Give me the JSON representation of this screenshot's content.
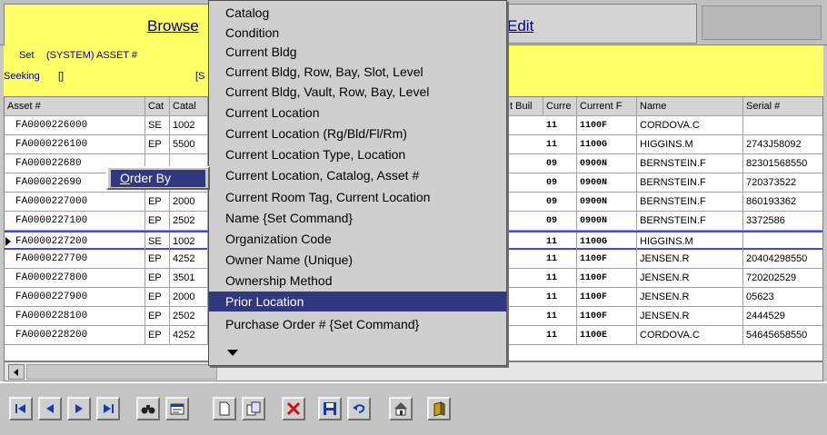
{
  "tabs": {
    "browse_label": "Browse",
    "edit_label": "Edit"
  },
  "info": {
    "set_label": "Set",
    "set_value": "(SYSTEM) ASSET #",
    "seeking_label": "Seeking",
    "seeking_value": "[]",
    "bracket": "[S"
  },
  "grid": {
    "columns": [
      "Asset #",
      "Cat",
      "Catal",
      "t Buil",
      "Curre",
      "Current F",
      "Name",
      "Serial #"
    ],
    "rows": [
      {
        "asset": "FA0000226000",
        "cat": "SE",
        "catalog": "1002",
        "curr": "11",
        "room": "1100F",
        "name": "CORDOVA.C",
        "serial": ""
      },
      {
        "asset": "FA0000226100",
        "cat": "EP",
        "catalog": "5500",
        "curr": "11",
        "room": "1100G",
        "name": "HIGGINS.M",
        "serial": "2743J58092"
      },
      {
        "asset": "FA000022680",
        "cat": "",
        "catalog": "",
        "curr": "09",
        "room": "0900N",
        "name": "BERNSTEIN.F",
        "serial": "82301568550"
      },
      {
        "asset": "FA000022690",
        "cat": "",
        "catalog": "",
        "curr": "09",
        "room": "0900N",
        "name": "BERNSTEIN.F",
        "serial": "720373522"
      },
      {
        "asset": "FA0000227000",
        "cat": "EP",
        "catalog": "2000",
        "curr": "09",
        "room": "0900N",
        "name": "BERNSTEIN.F",
        "serial": "860193362"
      },
      {
        "asset": "FA0000227100",
        "cat": "EP",
        "catalog": "2502",
        "curr": "09",
        "room": "0900N",
        "name": "BERNSTEIN.F",
        "serial": "3372586"
      },
      {
        "asset": "FA0000227200",
        "cat": "SE",
        "catalog": "1002",
        "curr": "11",
        "room": "1100G",
        "name": "HIGGINS.M",
        "serial": ""
      },
      {
        "asset": "FA0000227700",
        "cat": "EP",
        "catalog": "4252",
        "curr": "11",
        "room": "1100F",
        "name": "JENSEN.R",
        "serial": "20404298550"
      },
      {
        "asset": "FA0000227800",
        "cat": "EP",
        "catalog": "3501",
        "curr": "11",
        "room": "1100F",
        "name": "JENSEN.R",
        "serial": "720202529"
      },
      {
        "asset": "FA0000227900",
        "cat": "EP",
        "catalog": "2000",
        "curr": "11",
        "room": "1100F",
        "name": "JENSEN.R",
        "serial": "05623"
      },
      {
        "asset": "FA0000228100",
        "cat": "EP",
        "catalog": "2502",
        "curr": "11",
        "room": "1100F",
        "name": "JENSEN.R",
        "serial": "2444529"
      },
      {
        "asset": "FA0000228200",
        "cat": "EP",
        "catalog": "4252",
        "curr": "11",
        "room": "1100E",
        "name": "CORDOVA.C",
        "serial": "54645658550"
      }
    ]
  },
  "menu": {
    "items": [
      "Catalog",
      "Condition",
      "Current Bldg",
      "Current Bldg, Row, Bay, Slot, Level",
      "Current Bldg, Vault, Row, Bay, Level",
      "Current Location",
      "Current Location (Rg/Bld/Fl/Rm)",
      "Current Location Type, Location",
      "Current Location, Catalog, Asset #",
      "Current Room Tag, Current Location",
      "Name {Set Command}",
      "Organization Code",
      "Owner Name (Unique)",
      "Ownership Method",
      "Prior Location",
      "Purchase Order # {Set Command}"
    ],
    "highlighted_index": 14
  },
  "popup": {
    "label_mnemonic": "O",
    "label_rest": "rder By"
  },
  "colors": {
    "highlight": "#303880",
    "band": "#ffff66",
    "selection_border": "#4040ff"
  },
  "toolbar": {
    "icons": [
      "first-record-icon",
      "previous-record-icon",
      "next-record-icon",
      "last-record-icon",
      "binoculars-icon",
      "form-view-icon",
      "new-record-icon",
      "copy-record-icon",
      "delete-icon",
      "save-icon",
      "undo-icon",
      "home-icon",
      "book-icon"
    ]
  }
}
